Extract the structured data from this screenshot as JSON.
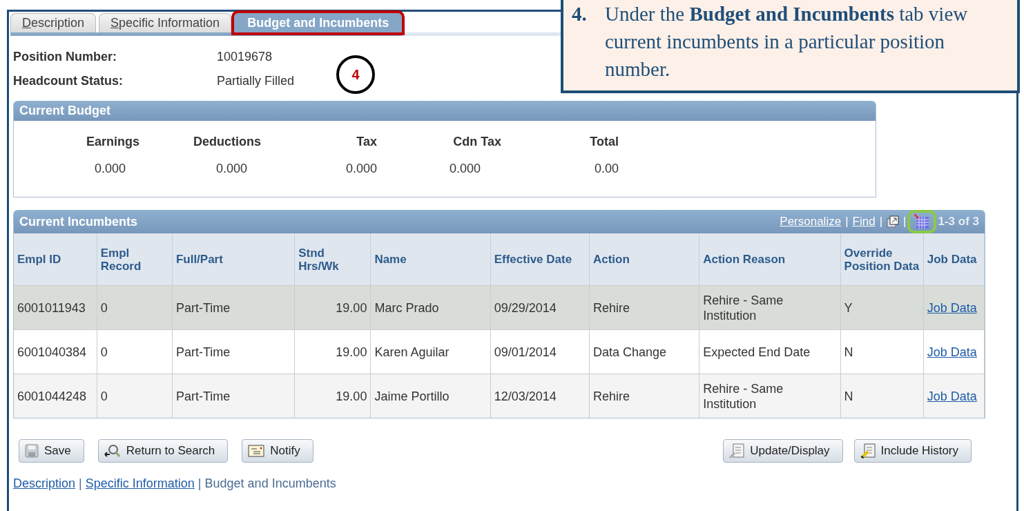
{
  "tabs": [
    {
      "label": "Description",
      "selected": false,
      "underlined_initial": true
    },
    {
      "label": "Specific Information",
      "selected": false,
      "underlined_initial": true
    },
    {
      "label": "Budget and Incumbents",
      "selected": true,
      "underlined_initial": false
    }
  ],
  "step_marker": "4",
  "callout": {
    "number": "4.",
    "text": "Under the **Budget and Incumbents** tab view current incumbents in a particular position number."
  },
  "fields": [
    {
      "label": "Position Number:",
      "value": "10019678"
    },
    {
      "label": "Headcount Status:",
      "value": "Partially Filled"
    }
  ],
  "current_budget": {
    "title": "Current Budget",
    "columns": [
      {
        "label": "Earnings",
        "value": "0.000"
      },
      {
        "label": "Deductions",
        "value": "0.000"
      },
      {
        "label": "Tax",
        "value": "0.000"
      },
      {
        "label": "Cdn Tax",
        "value": "0.000"
      },
      {
        "label": "Total",
        "value": "0.00"
      }
    ]
  },
  "current_incumbents": {
    "title": "Current Incumbents",
    "toolbar": [
      {
        "kind": "link",
        "label": "Personalize"
      },
      {
        "kind": "separator",
        "label": "|"
      },
      {
        "kind": "link",
        "label": "Find"
      },
      {
        "kind": "separator",
        "label": "|"
      },
      {
        "kind": "new_window"
      },
      {
        "kind": "separator",
        "label": "|"
      },
      {
        "kind": "grid"
      }
    ],
    "count": "1-3 of 3",
    "columns": [
      "Empl ID",
      "Empl Record",
      "Full/Part",
      "Stnd Hrs/Wk",
      "Name",
      "Effective Date",
      "Action",
      "Action Reason",
      "Override Position Data",
      "Job Data"
    ],
    "rows": [
      {
        "selected": true,
        "cells": [
          "6001011943",
          "0",
          "Part-Time",
          "19.00",
          "Marc Prado",
          "09/29/2014",
          "Rehire",
          "Rehire - Same Institution",
          "Y"
        ],
        "link": "Job Data"
      },
      {
        "selected": false,
        "cells": [
          "6001040384",
          "0",
          "Part-Time",
          "19.00",
          "Karen Aguilar",
          "09/01/2014",
          "Data Change",
          "Expected End Date",
          "N"
        ],
        "link": "Job Data"
      },
      {
        "selected": false,
        "cells": [
          "6001044248",
          "0",
          "Part-Time",
          "19.00",
          "Jaime Portillo",
          "12/03/2014",
          "Rehire",
          "Rehire - Same Institution",
          "N"
        ],
        "link": "Job Data"
      }
    ]
  },
  "buttons_left": [
    {
      "kind": "save",
      "label": "Save"
    },
    {
      "kind": "search",
      "label": "Return to Search"
    },
    {
      "kind": "notify",
      "label": "Notify"
    }
  ],
  "buttons_right": [
    {
      "kind": "update",
      "label": "Update/Display"
    },
    {
      "kind": "history",
      "label": "Include History"
    }
  ],
  "footer_links": [
    {
      "kind": "link",
      "label": "Description"
    },
    {
      "kind": "separator",
      "label": "|"
    },
    {
      "kind": "link",
      "label": "Specific Information"
    },
    {
      "kind": "separator",
      "label": "|"
    },
    {
      "kind": "current",
      "label": "Budget and Incumbents"
    }
  ]
}
